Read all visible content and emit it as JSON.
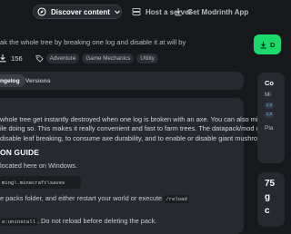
{
  "nav": {
    "discover": {
      "label": "Discover content",
      "icon": "compass-icon"
    },
    "host": {
      "label": "Host a server",
      "icon": "server-icon"
    },
    "app": {
      "label": "Get Modrinth App",
      "icon": "download-icon"
    }
  },
  "project": {
    "summary": "ak the whole tree by breaking one log and disable it at will by",
    "downloads": "156",
    "tags": [
      "Adventure",
      "Game Mechanics",
      "Utility"
    ],
    "download_button": "D"
  },
  "tabs": [
    "ngelog",
    "Versions"
  ],
  "description": {
    "para1_l1": "whole tree get instantly destroyed when one log is broken with an axe. You can also mine",
    "para1_l2": "ile doing so. This makes it really convenient and fast to farm trees. The datapack/mod can",
    "para1_l3": "disable leaf breaking, to consume axe durability, and to enable or disable giant mushrooms.",
    "heading": "ON GUIDE",
    "line_location": "located here on Windows.",
    "code_path": "ming\\.minecraft\\saves",
    "line_reload_prefix": "e packs folder, and either restart your world or execute",
    "reload_cmd": "/reload",
    "line_last_code": "e:uninstall",
    "line_last_rest": ". Do not reload before deleting the pack."
  },
  "sidebar": {
    "title": "Co",
    "label1": "Mi",
    "chip1": "1.2",
    "chip2": "1.2",
    "label2": "Pla",
    "big1": "75",
    "big2": "g",
    "big3": "c"
  },
  "colors": {
    "accent": "#1bd96a",
    "background": "#16181c",
    "card": "#26292f"
  }
}
